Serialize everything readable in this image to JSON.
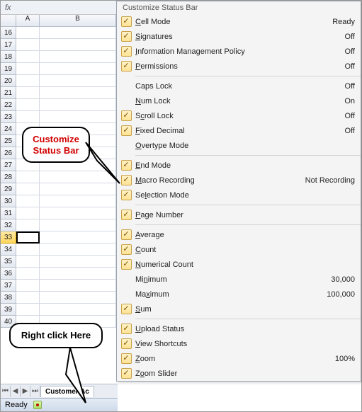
{
  "formula_bar": {
    "fx": "fx"
  },
  "columns": [
    "A",
    "B"
  ],
  "rows": [
    16,
    17,
    18,
    19,
    20,
    21,
    22,
    23,
    24,
    25,
    26,
    27,
    28,
    29,
    30,
    31,
    32,
    33,
    34,
    35,
    36,
    37,
    38,
    39,
    40
  ],
  "selected_row": 33,
  "sheet_tab": "Customer Ac",
  "status_text": "Ready",
  "menu_title": "Customize Status Bar",
  "menu": [
    {
      "checked": true,
      "label": "Cell Mode",
      "u": 0,
      "value": "Ready"
    },
    {
      "checked": true,
      "label": "Signatures",
      "u": 0,
      "value": "Off"
    },
    {
      "checked": true,
      "label": "Information Management Policy",
      "u": 0,
      "value": "Off"
    },
    {
      "checked": true,
      "label": "Permissions",
      "u": 0,
      "value": "Off"
    },
    {
      "sep": true
    },
    {
      "checked": false,
      "label": "Caps Lock",
      "u": null,
      "value": "Off"
    },
    {
      "checked": false,
      "label": "Num Lock",
      "u": 0,
      "value": "On"
    },
    {
      "checked": true,
      "label": "Scroll Lock",
      "u": 1,
      "value": "Off"
    },
    {
      "checked": true,
      "label": "Fixed Decimal",
      "u": 0,
      "value": "Off"
    },
    {
      "checked": false,
      "label": "Overtype Mode",
      "u": 0,
      "value": ""
    },
    {
      "sep": true
    },
    {
      "checked": true,
      "label": "End Mode",
      "u": 0,
      "value": ""
    },
    {
      "checked": true,
      "label": "Macro Recording",
      "u": 0,
      "value": "Not Recording"
    },
    {
      "checked": true,
      "label": "Selection Mode",
      "u": 2,
      "value": ""
    },
    {
      "sep": true
    },
    {
      "checked": true,
      "label": "Page Number",
      "u": 0,
      "value": ""
    },
    {
      "sep": true
    },
    {
      "checked": true,
      "label": "Average",
      "u": 0,
      "value": ""
    },
    {
      "checked": true,
      "label": "Count",
      "u": 0,
      "value": ""
    },
    {
      "checked": true,
      "label": "Numerical Count",
      "u": 0,
      "value": ""
    },
    {
      "checked": false,
      "label": "Minimum",
      "u": 2,
      "value": "30,000"
    },
    {
      "checked": false,
      "label": "Maximum",
      "u": 2,
      "value": "100,000"
    },
    {
      "checked": true,
      "label": "Sum",
      "u": 0,
      "value": ""
    },
    {
      "sep": true
    },
    {
      "checked": true,
      "label": "Upload Status",
      "u": 0,
      "value": ""
    },
    {
      "checked": true,
      "label": "View Shortcuts",
      "u": 0,
      "value": ""
    },
    {
      "checked": true,
      "label": "Zoom",
      "u": 0,
      "value": "100%"
    },
    {
      "checked": true,
      "label": "Zoom Slider",
      "u": 1,
      "value": ""
    }
  ],
  "callout1_line1": "Customize",
  "callout1_line2": "Status Bar",
  "callout2_text": "Right click Here"
}
